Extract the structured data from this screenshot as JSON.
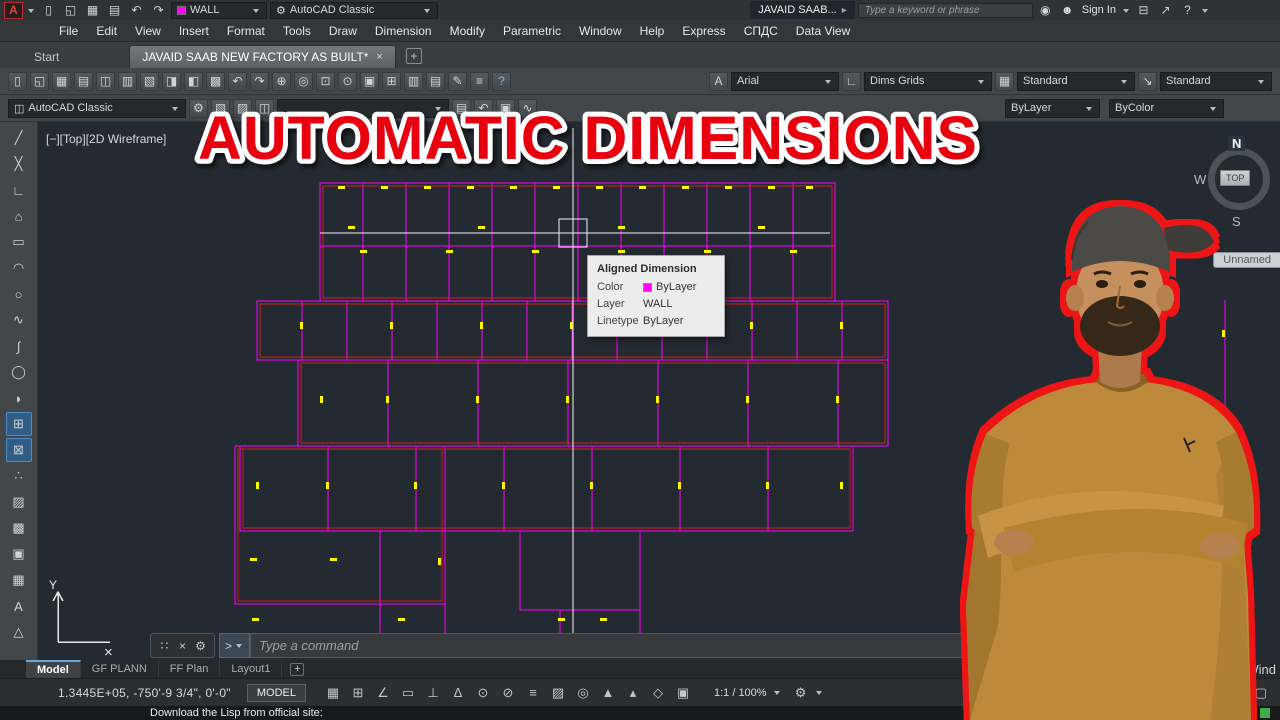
{
  "app": {
    "workspace": "WALL",
    "classic": "AutoCAD Classic",
    "doc_tab": "JAVAID SAAB...",
    "search_placeholder": "Type a keyword or phrase",
    "sign_in": "Sign In"
  },
  "colors": {
    "wall_magenta": "#ff00ff",
    "wall_red": "#d02020",
    "dimension_yellow": "#ffff00",
    "overlay_red": "#e8000f",
    "person_outline_red": "#ed1515"
  },
  "qat_icons": [
    {
      "name": "new-file-icon",
      "glyph": "▯"
    },
    {
      "name": "open-file-icon",
      "glyph": "◱"
    },
    {
      "name": "save-icon",
      "glyph": "▦"
    },
    {
      "name": "plot-icon",
      "glyph": "▤"
    },
    {
      "name": "undo-icon",
      "glyph": "↶"
    },
    {
      "name": "redo-icon",
      "glyph": "↷"
    }
  ],
  "account_icons": [
    {
      "name": "exchange-apps-icon",
      "glyph": "◉"
    },
    {
      "name": "user-avatar-icon",
      "glyph": "☻"
    }
  ],
  "account_icons2": [
    {
      "name": "cart-icon",
      "glyph": "⊟"
    },
    {
      "name": "share-icon",
      "glyph": "↗"
    },
    {
      "name": "help-icon",
      "glyph": "?"
    }
  ],
  "menus": [
    {
      "name": "menu-file",
      "label": "File"
    },
    {
      "name": "menu-edit",
      "label": "Edit"
    },
    {
      "name": "menu-view",
      "label": "View"
    },
    {
      "name": "menu-insert",
      "label": "Insert"
    },
    {
      "name": "menu-format",
      "label": "Format"
    },
    {
      "name": "menu-tools",
      "label": "Tools"
    },
    {
      "name": "menu-draw",
      "label": "Draw"
    },
    {
      "name": "menu-dimension",
      "label": "Dimension"
    },
    {
      "name": "menu-modify",
      "label": "Modify"
    },
    {
      "name": "menu-parametric",
      "label": "Parametric"
    },
    {
      "name": "menu-window",
      "label": "Window"
    },
    {
      "name": "menu-help",
      "label": "Help"
    },
    {
      "name": "menu-express",
      "label": "Express"
    },
    {
      "name": "menu-spds",
      "label": "СПДС"
    },
    {
      "name": "menu-data-view",
      "label": "Data View"
    }
  ],
  "file_tabs": {
    "start": "Start",
    "active": "JAVAID SAAB NEW FACTORY AS BUILT*",
    "close": "×",
    "new_tab": "+"
  },
  "toolbar1_icons": [
    {
      "name": "new-file-icon",
      "glyph": "▯"
    },
    {
      "name": "open-file-icon",
      "glyph": "◱"
    },
    {
      "name": "save-file-icon",
      "glyph": "▦"
    },
    {
      "name": "plot-icon",
      "glyph": "▤"
    },
    {
      "name": "plot-preview-icon",
      "glyph": "◫"
    },
    {
      "name": "publish-icon",
      "glyph": "▥"
    },
    {
      "name": "cut-icon",
      "glyph": "▧"
    },
    {
      "name": "copy-icon",
      "glyph": "◨"
    },
    {
      "name": "paste-icon",
      "glyph": "◧"
    },
    {
      "name": "match-properties-icon",
      "glyph": "▩"
    },
    {
      "name": "undo-icon",
      "glyph": "↶"
    },
    {
      "name": "redo-icon",
      "glyph": "↷"
    },
    {
      "name": "pan-icon",
      "glyph": "⊕"
    },
    {
      "name": "zoom-realtime-icon",
      "glyph": "◎"
    },
    {
      "name": "zoom-window-icon",
      "glyph": "⊡"
    },
    {
      "name": "zoom-previous-icon",
      "glyph": "⊙"
    },
    {
      "name": "properties-palette-icon",
      "glyph": "▣"
    },
    {
      "name": "design-center-icon",
      "glyph": "⊞"
    },
    {
      "name": "tool-palettes-icon",
      "glyph": "▥"
    },
    {
      "name": "sheet-set-manager-icon",
      "glyph": "▤"
    },
    {
      "name": "markup-set-manager-icon",
      "glyph": "✎"
    },
    {
      "name": "quick-calc-icon",
      "glyph": "≡"
    },
    {
      "name": "help-icon-toolbar",
      "glyph": "?",
      "accent": true
    }
  ],
  "toolbar1": {
    "text_style": "Arial",
    "dim_style": "Dims Grids",
    "table_style": "Standard",
    "mleader_style": "Standard"
  },
  "toolbar1_combo_icons": [
    {
      "name": "text-style-icon",
      "glyph": "A"
    },
    {
      "name": "dim-style-icon",
      "glyph": "∟"
    },
    {
      "name": "table-style-icon",
      "glyph": "▦"
    },
    {
      "name": "mleader-style-icon",
      "glyph": "↘"
    }
  ],
  "toolbar2_icons_a": [
    {
      "name": "layer-properties-icon",
      "glyph": "▧"
    },
    {
      "name": "layer-states-icon",
      "glyph": "▨"
    },
    {
      "name": "layer-isolate-icon",
      "glyph": "◫"
    }
  ],
  "toolbar2_icons_b": [
    {
      "name": "make-current-layer-icon",
      "glyph": "▤"
    },
    {
      "name": "layer-previous-icon",
      "glyph": "↶"
    },
    {
      "name": "properties-match-icon",
      "glyph": "▣"
    },
    {
      "name": "linetype-manager-icon",
      "glyph": "∿"
    }
  ],
  "toolbar2": {
    "workspace": "AutoCAD Classic",
    "layer_value": "",
    "color": "ByLayer",
    "plot_style": "ByColor"
  },
  "palette_icons": [
    {
      "name": "line-icon",
      "glyph": "╱"
    },
    {
      "name": "construction-line-icon",
      "glyph": "╳"
    },
    {
      "name": "polyline-icon",
      "glyph": "∟"
    },
    {
      "name": "polygon-icon",
      "glyph": "⌂"
    },
    {
      "name": "rectangle-icon",
      "glyph": "▭"
    },
    {
      "name": "arc-icon",
      "glyph": "◠"
    },
    {
      "name": "circle-icon",
      "glyph": "○"
    },
    {
      "name": "revision-cloud-icon",
      "glyph": "∿"
    },
    {
      "name": "spline-icon",
      "glyph": "∫"
    },
    {
      "name": "ellipse-icon",
      "glyph": "◯"
    },
    {
      "name": "ellipse-arc-icon",
      "glyph": "◗"
    },
    {
      "name": "insert-block-icon",
      "glyph": "⊞",
      "active": true
    },
    {
      "name": "make-block-icon",
      "glyph": "⊠",
      "active": true
    },
    {
      "name": "point-icon",
      "glyph": "∴"
    },
    {
      "name": "hatch-icon",
      "glyph": "▨"
    },
    {
      "name": "gradient-icon",
      "glyph": "▩"
    },
    {
      "name": "region-icon",
      "glyph": "▣"
    },
    {
      "name": "table-icon",
      "glyph": "▦"
    },
    {
      "name": "multiline-text-icon",
      "glyph": "A"
    },
    {
      "name": "scale-tool-icon",
      "glyph": "△"
    }
  ],
  "overlay": {
    "title": "AUTOMATIC DIMENSIONS"
  },
  "canvas": {
    "viewport_label": "[−][Top][2D Wireframe]"
  },
  "tooltip": {
    "title": "Aligned Dimension",
    "color_label": "Color",
    "color_value": "ByLayer",
    "layer_label": "Layer",
    "layer_value": "WALL",
    "linetype_label": "Linetype",
    "linetype_value": "ByLayer"
  },
  "compass": {
    "n": "N",
    "w": "W",
    "s": "S",
    "top": "TOP"
  },
  "labels": {
    "unnamed": "Unnamed",
    "watermark_fragment": "te Wind",
    "ucs_y": "Y",
    "ucs_x_marker": "×"
  },
  "command": {
    "placeholder": "Type a command",
    "prompt": ">"
  },
  "cmd_icons": [
    {
      "name": "command-grip-icon",
      "glyph": "∷"
    },
    {
      "name": "close-command-icon",
      "glyph": "×"
    },
    {
      "name": "customize-command-icon",
      "glyph": "⚙"
    }
  ],
  "layout_tabs": [
    {
      "name": "tab-model",
      "label": "Model",
      "active": true
    },
    {
      "name": "tab-gf-plann",
      "label": "GF PLANN"
    },
    {
      "name": "tab-ff-plan",
      "label": "FF Plan"
    },
    {
      "name": "tab-layout1",
      "label": "Layout1"
    }
  ],
  "status": {
    "coords": "1.3445E+05, -750'-9 3/4\", 0'-0\"",
    "model_button": "MODEL",
    "scale": "1:1 / 100%"
  },
  "status_icons": [
    {
      "name": "grid-display-icon",
      "glyph": "▦",
      "accent": true
    },
    {
      "name": "snap-mode-icon",
      "glyph": "⊞"
    },
    {
      "name": "infer-constraints-icon",
      "glyph": "∠"
    },
    {
      "name": "dynamic-input-icon",
      "glyph": "▭"
    },
    {
      "name": "ortho-mode-icon",
      "glyph": "⊥"
    },
    {
      "name": "polar-tracking-icon",
      "glyph": "∆"
    },
    {
      "name": "object-snap-icon",
      "glyph": "⊙",
      "accent": true
    },
    {
      "name": "object-snap-tracking-icon",
      "glyph": "⊘"
    },
    {
      "name": "lineweight-display-icon",
      "glyph": "≡"
    },
    {
      "name": "transparency-icon",
      "glyph": "▨"
    },
    {
      "name": "selection-cycling-icon",
      "glyph": "◎"
    },
    {
      "name": "annotation-visibility-icon",
      "glyph": "▲",
      "accent": true
    },
    {
      "name": "autoscale-icon",
      "glyph": "▴"
    },
    {
      "name": "units-icon",
      "glyph": "◇"
    },
    {
      "name": "quick-properties-icon",
      "glyph": "▣"
    }
  ],
  "status_right_icons": [
    {
      "name": "isolate-objects-icon",
      "glyph": "◉",
      "accent": true
    },
    {
      "name": "clean-screen-icon",
      "glyph": "▢"
    }
  ],
  "bottom": {
    "text": "Download the Lisp from official site:"
  }
}
